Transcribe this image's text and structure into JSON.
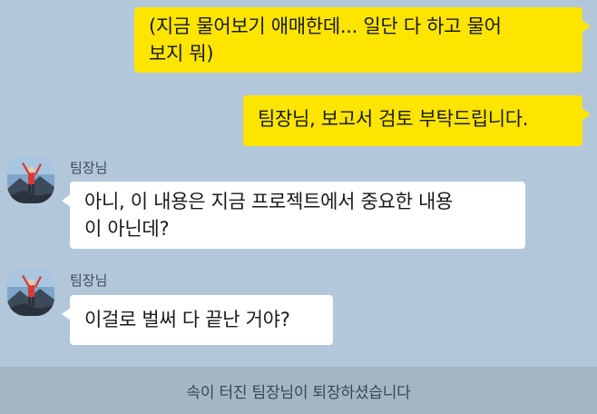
{
  "messages": {
    "out1": {
      "lines": [
        "(지금 물어보기 애매한데... 일단 다 하고 물어",
        "보지 뭐)"
      ]
    },
    "out2": {
      "text": "팀장님, 보고서 검토 부탁드립니다."
    },
    "in1": {
      "sender": "팀장님",
      "lines": [
        "아니, 이 내용은 지금 프로젝트에서 중요한 내용",
        "이 아닌데?"
      ]
    },
    "in2": {
      "sender": "팀장님",
      "text": "이걸로 벌써 다 끝난 거야?"
    }
  },
  "notice": {
    "text": "속이 터진 팀장님이 퇴장하셨습니다"
  },
  "colors": {
    "background": "#b2c7d9",
    "outgoing_bubble": "#fee500",
    "incoming_bubble": "#ffffff",
    "notice_bar": "#a4b6c6"
  }
}
